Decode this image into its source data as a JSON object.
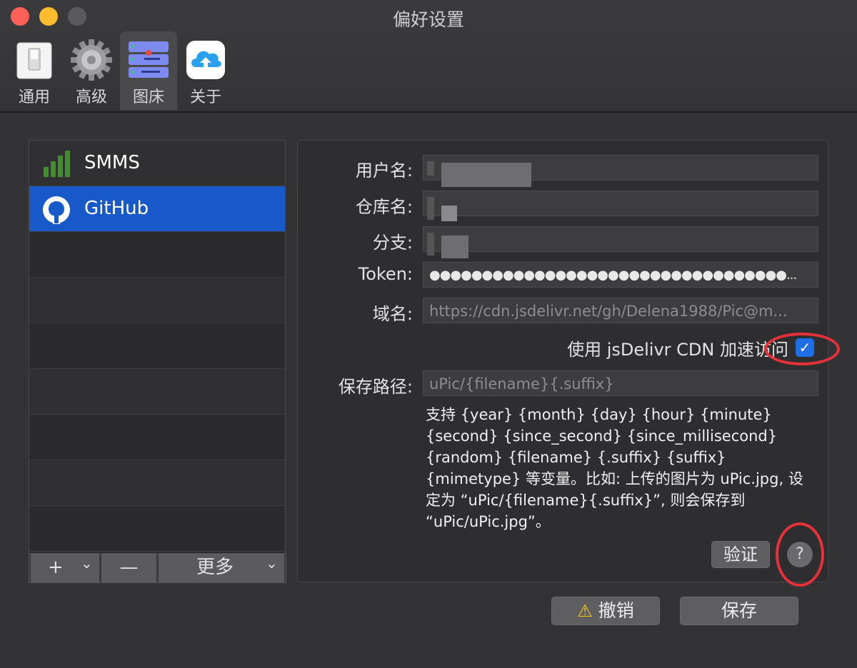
{
  "window": {
    "title": "偏好设置"
  },
  "toolbar": {
    "items": [
      {
        "label": "通用",
        "icon": "switch-icon"
      },
      {
        "label": "高级",
        "icon": "gear-icon"
      },
      {
        "label": "图床",
        "icon": "server-icon"
      },
      {
        "label": "关于",
        "icon": "upic-cloud-icon"
      }
    ],
    "active": "图床"
  },
  "hosts": {
    "items": [
      {
        "label": "SMMS",
        "icon": "signal-bars-icon"
      },
      {
        "label": "GitHub",
        "icon": "github-icon"
      }
    ],
    "selected": "GitHub",
    "footer": {
      "add": "+",
      "add_chevron": "⌄",
      "remove": "—",
      "more": "更多",
      "more_chevron": "⌄"
    }
  },
  "form": {
    "username_label": "用户名:",
    "repo_label": "仓库名:",
    "branch_label": "分支:",
    "token_label": "Token:",
    "token_value": "●●●●●●●●●●●●●●●●●●●●●●●●●●●●●●●●●●...",
    "domain_label": "域名:",
    "domain_placeholder": "https://cdn.jsdelivr.net/gh/Delena1988/Pic@m...",
    "cdn_label": "使用 jsDelivr CDN 加速访问",
    "cdn_checked": "✓",
    "save_path_label": "保存路径:",
    "save_path_placeholder": "uPic/{filename}{.suffix}",
    "help_text": "支持 {year} {month} {day} {hour} {minute} {second} {since_second} {since_millisecond} {random} {filename} {.suffix} {suffix} {mimetype} 等变量。比如: 上传的图片为 uPic.jpg, 设定为 “uPic/{filename}{.suffix}”, 则会保存到 “uPic/uPic.jpg”。",
    "verify_label": "验证",
    "help_button": "?"
  },
  "actions": {
    "cancel_label": "撤销",
    "save_label": "保存"
  },
  "colors": {
    "selection": "#1759c8",
    "annotation": "#e5313a",
    "checkbox": "#1e6fe6"
  }
}
